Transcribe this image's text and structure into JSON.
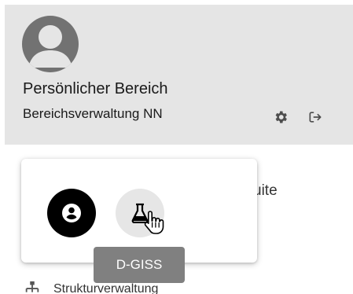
{
  "account": {
    "title": "Persönlicher Bereich",
    "subtitle": "Bereichsverwaltung NN",
    "actions": {
      "settings_icon": "gear-icon",
      "logout_icon": "logout-icon"
    }
  },
  "background_menu": {
    "partial_text": "uite"
  },
  "app_switcher": {
    "apps": [
      {
        "icon": "account-circle-icon",
        "state": "selected"
      },
      {
        "icon": "flask-icon",
        "state": "hovered"
      }
    ],
    "tooltip": "D-GISS"
  },
  "nav": {
    "items": [
      {
        "icon": "sitemap-icon",
        "label": "Strukturverwaltung"
      }
    ]
  },
  "colors": {
    "header_bg": "#e5e5e5",
    "avatar": "#727272",
    "tooltip_bg": "#808080",
    "selected_app_bg": "#000000",
    "hover_app_bg": "#e6e6e6"
  }
}
